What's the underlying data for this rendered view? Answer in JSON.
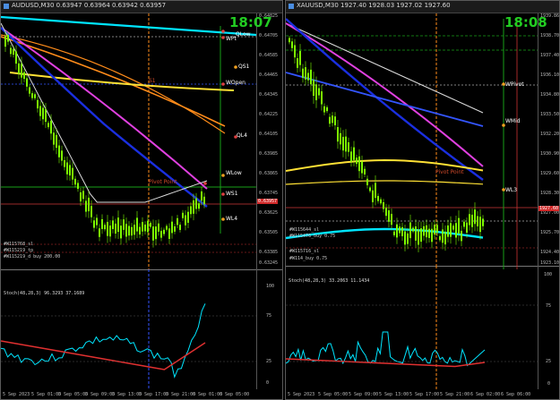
{
  "left": {
    "title": "AUDUSD,M30 0.63947 0.63964 0.63942 0.63957",
    "clock": "18:07",
    "levels": [
      {
        "label": "QLow",
        "color": "#dddddd"
      },
      {
        "label": "WPt",
        "color": "#dddddd"
      },
      {
        "label": "QS1",
        "color": "#dddddd"
      },
      {
        "label": "WOpen",
        "color": "#dddddd"
      },
      {
        "label": "QL4",
        "color": "#dddddd"
      },
      {
        "label": "WLow",
        "color": "#dddddd"
      },
      {
        "label": "WS1",
        "color": "#dddddd"
      },
      {
        "label": "WL4",
        "color": "#dddddd"
      },
      {
        "label": "Pivot Point",
        "color": "#d04a2a"
      },
      {
        "label": "S1",
        "color": "#d04a2a"
      }
    ],
    "prices": [
      "0.64825",
      "0.64705",
      "0.64585",
      "0.64465",
      "0.64345",
      "0.64225",
      "0.64105",
      "0.63985",
      "0.63865",
      "0.63745",
      "0.63625",
      "0.63505",
      "0.63385"
    ],
    "current_price": "0.63957",
    "bottom_price": "0.63245",
    "sub_labels": [
      "#W115768_sl",
      "#W115219_tp",
      "#W115219_d buy 200.00"
    ],
    "indicator": {
      "title": "Stoch(48,28,3) 96.3293 37.1689",
      "ticks": [
        "100",
        "75",
        "25",
        "0"
      ]
    },
    "time_axis": [
      "5 Sep 2023",
      "5 Sep 01:00",
      "5 Sep 05:00",
      "5 Sep 09:00",
      "5 Sep 13:00",
      "5 Sep 17:00",
      "5 Sep 21:00",
      "6 Sep 01:00",
      "6 Sep 05:00"
    ]
  },
  "right": {
    "title": "XAUUSD,M30 1927.40 1928.03 1927.02 1927.60",
    "clock": "18:08",
    "levels": [
      {
        "label": "WPivot",
        "color": "#dddddd"
      },
      {
        "label": "WMid",
        "color": "#dddddd"
      },
      {
        "label": "WL3",
        "color": "#dddddd"
      },
      {
        "label": "Pivot Point",
        "color": "#d04a2a"
      }
    ],
    "prices": [
      "1939.86",
      "1938.70",
      "1937.40",
      "1936.10",
      "1934.80",
      "1933.50",
      "1932.20",
      "1930.90",
      "1929.60",
      "1928.30",
      "1927.00",
      "1925.70",
      "1924.40"
    ],
    "current_price": "1927.60",
    "bottom_price": "1923.10",
    "sub_labels": [
      "#W115644_sl",
      "#W115476_buy 0.75",
      "#W115716_sl",
      "#W114_buy 0.75"
    ],
    "indicator": {
      "title": "Stoch(48,28,3) 33.2063 11.1434",
      "ticks": [
        "100",
        "75",
        "25",
        "0"
      ]
    },
    "time_axis": [
      "5 Sep 2023",
      "5 Sep 05:00",
      "5 Sep 09:00",
      "5 Sep 13:00",
      "5 Sep 17:00",
      "5 Sep 21:00",
      "6 Sep 02:00",
      "6 Sep 06:00"
    ]
  },
  "colors": {
    "cyan": "#00e5ff",
    "orange": "#ff8c1a",
    "yellow": "#ffe135",
    "magenta": "#e040e0",
    "blue": "#1a2fe0",
    "green": "#18a018",
    "red": "#e03030",
    "candle": "#7cfc00"
  }
}
